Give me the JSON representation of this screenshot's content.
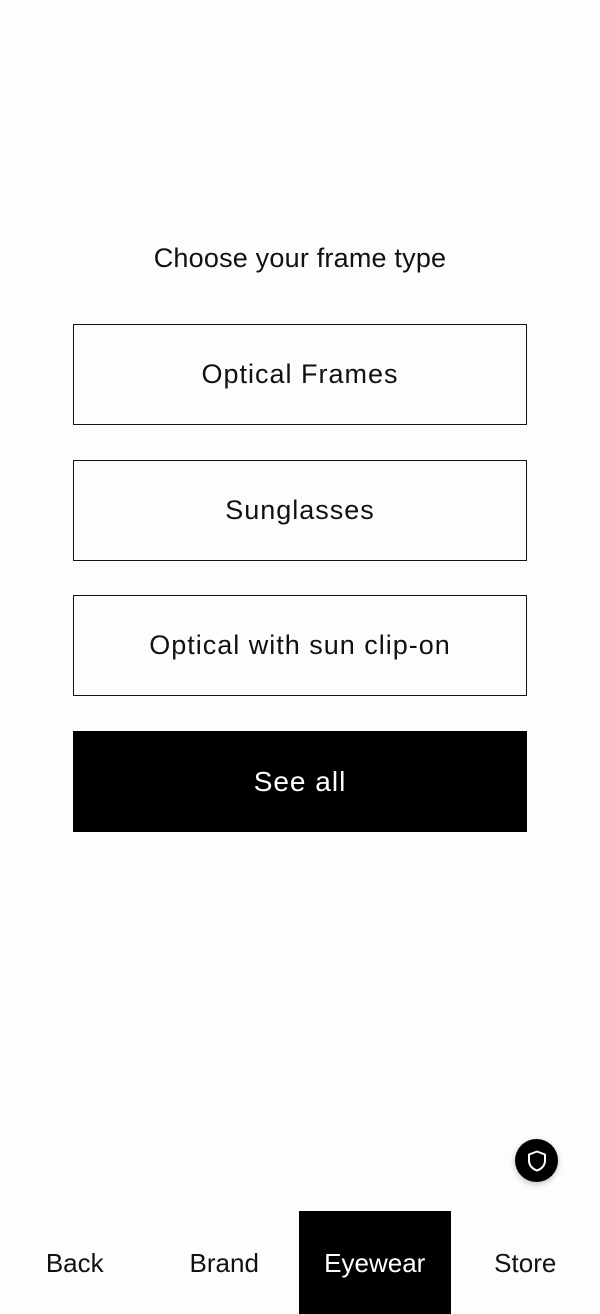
{
  "main": {
    "heading": "Choose your frame type",
    "options": [
      {
        "label": "Optical Frames"
      },
      {
        "label": "Sunglasses"
      },
      {
        "label": "Optical with sun clip-on"
      }
    ],
    "see_all_label": "See all"
  },
  "floating": {
    "icon": "shield-icon"
  },
  "bottom_nav": {
    "items": [
      {
        "label": "Back",
        "active": false
      },
      {
        "label": "Brand",
        "active": false
      },
      {
        "label": "Eyewear",
        "active": true
      },
      {
        "label": "Store",
        "active": false
      }
    ]
  },
  "colors": {
    "background": "#fdfdfd",
    "text": "#111111",
    "accent": "#000000",
    "accent_text": "#ffffff"
  }
}
